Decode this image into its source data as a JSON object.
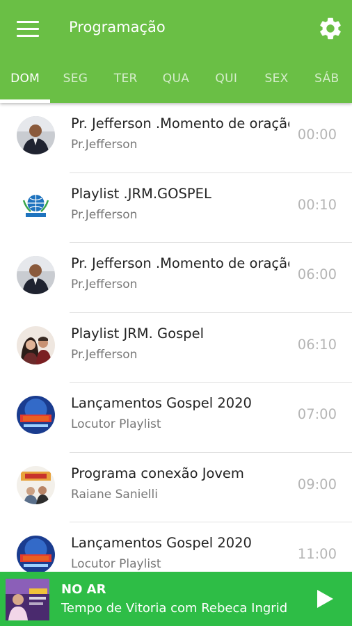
{
  "header": {
    "title": "Programação",
    "menu_icon": "menu-icon",
    "settings_icon": "gear-icon",
    "accent_color": "#6abf45"
  },
  "tabs": [
    {
      "label": "DOM",
      "active": true
    },
    {
      "label": "SEG",
      "active": false
    },
    {
      "label": "TER",
      "active": false
    },
    {
      "label": "QUA",
      "active": false
    },
    {
      "label": "QUI",
      "active": false
    },
    {
      "label": "SEX",
      "active": false
    },
    {
      "label": "SÁB",
      "active": false
    }
  ],
  "schedule": [
    {
      "title": "Pr. Jefferson .Momento de oração",
      "host": "Pr.Jefferson",
      "time": "00:00",
      "avatar": "host-photo"
    },
    {
      "title": "Playlist .JRM.GOSPEL",
      "host": "Pr.Jefferson",
      "time": "00:10",
      "avatar": "radio-logo"
    },
    {
      "title": "Pr. Jefferson .Momento de oração",
      "host": "Pr.Jefferson",
      "time": "06:00",
      "avatar": "host-photo"
    },
    {
      "title": "Playlist JRM. Gospel",
      "host": "Pr.Jefferson",
      "time": "06:10",
      "avatar": "couple-photo"
    },
    {
      "title": "Lançamentos Gospel 2020",
      "host": "Locutor Playlist",
      "time": "07:00",
      "avatar": "gospel-logo"
    },
    {
      "title": "Programa conexão Jovem",
      "host": "Raiane Sanielli",
      "time": "09:00",
      "avatar": "jovem-logo"
    },
    {
      "title": "Lançamentos Gospel 2020",
      "host": "Locutor Playlist",
      "time": "11:00",
      "avatar": "gospel-logo"
    }
  ],
  "player": {
    "status": "NO AR",
    "now_playing": "Tempo de Vitoria com Rebeca Ingrid",
    "play_icon": "play-icon",
    "background_color": "#2ebd46"
  }
}
